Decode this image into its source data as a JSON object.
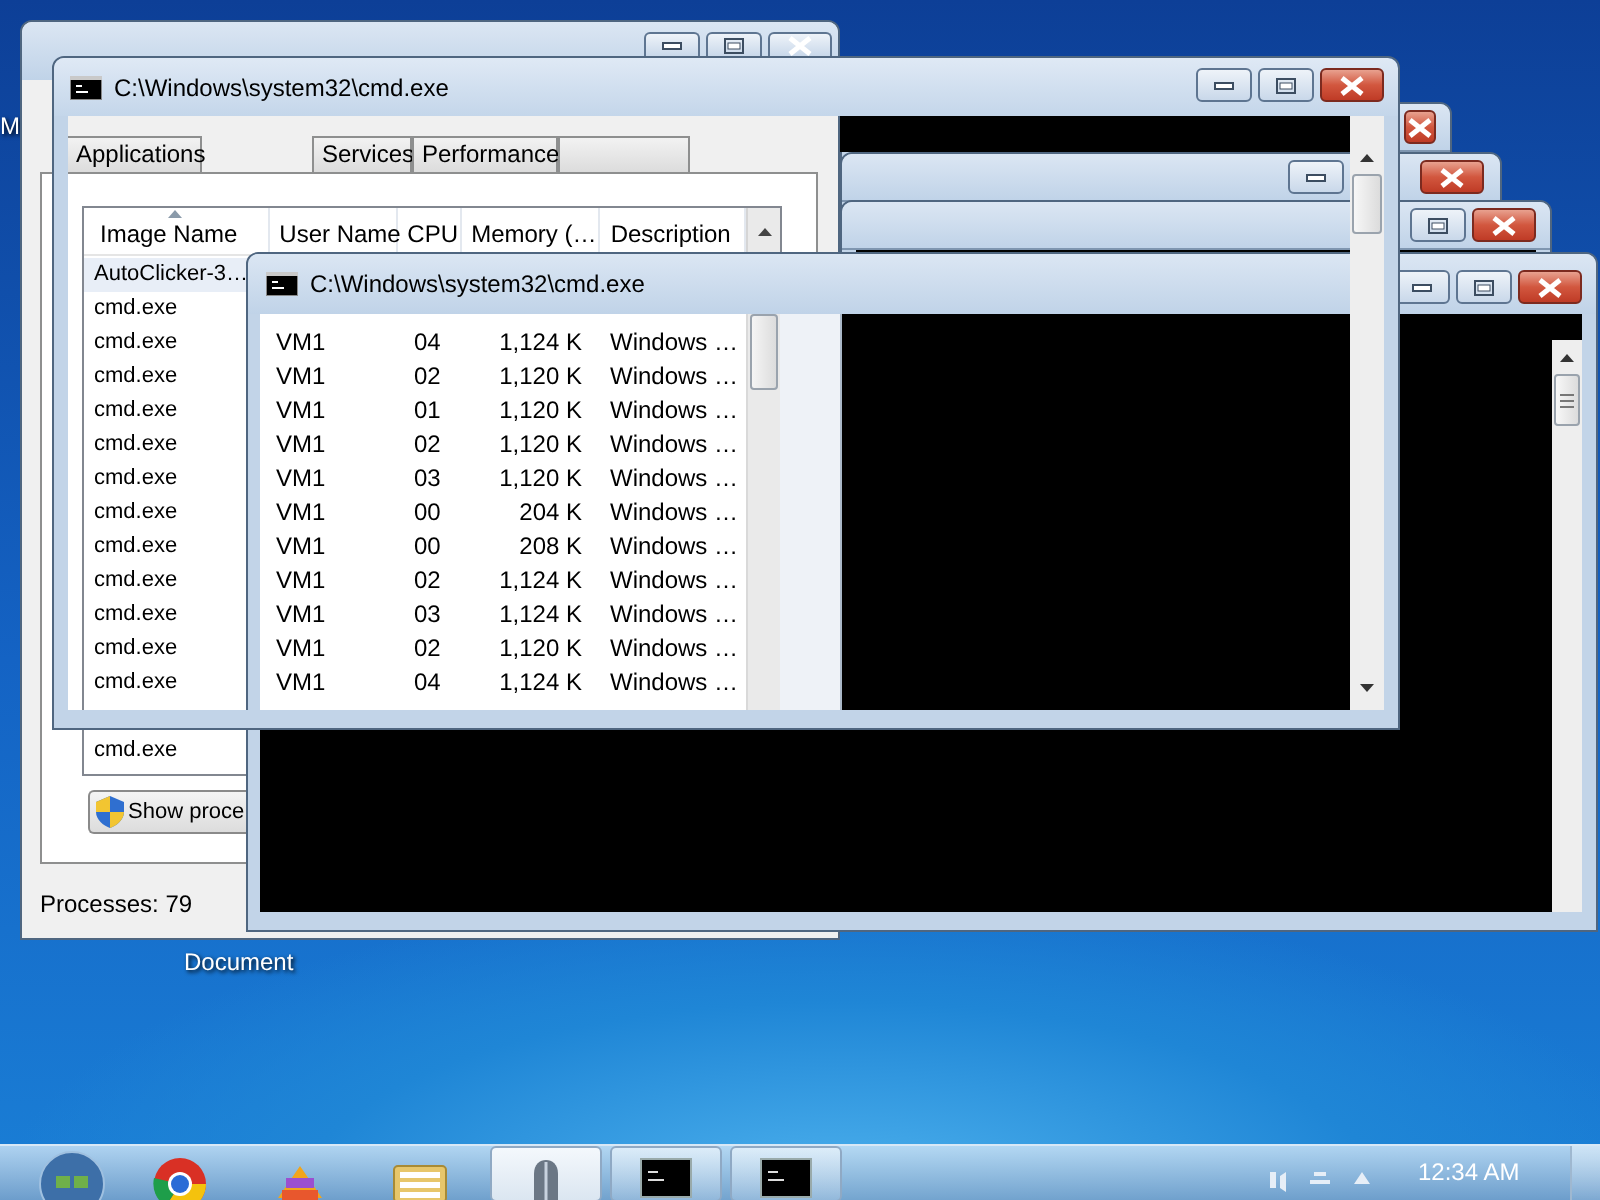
{
  "desktop": {
    "edge_label": "M",
    "icon_label": "Document"
  },
  "task_manager": {
    "tabs": [
      "Applications",
      "Services",
      "Performance"
    ],
    "columns": [
      "Image Name",
      "User Name",
      "CPU",
      "Memory (…",
      "Description"
    ],
    "image_names": [
      "AutoClicker-3…",
      "cmd.exe",
      "cmd.exe",
      "cmd.exe",
      "cmd.exe",
      "cmd.exe",
      "cmd.exe",
      "cmd.exe",
      "cmd.exe",
      "cmd.exe",
      "cmd.exe",
      "cmd.exe",
      "cmd.exe"
    ],
    "last_image_name": "cmd.exe",
    "button": "Show proce",
    "status": "Processes: 79"
  },
  "console_windows": [
    {
      "title": "C:\\Windows\\system32\\cmd.exe"
    },
    {
      "title": "C:\\Windows\\system32\\cmd.exe"
    }
  ],
  "process_rows": [
    {
      "user": "VM1",
      "cpu": "04",
      "memory": "1,124 K",
      "description": "Windows …"
    },
    {
      "user": "VM1",
      "cpu": "02",
      "memory": "1,120 K",
      "description": "Windows …"
    },
    {
      "user": "VM1",
      "cpu": "01",
      "memory": "1,120 K",
      "description": "Windows …"
    },
    {
      "user": "VM1",
      "cpu": "02",
      "memory": "1,120 K",
      "description": "Windows …"
    },
    {
      "user": "VM1",
      "cpu": "03",
      "memory": "1,120 K",
      "description": "Windows …"
    },
    {
      "user": "VM1",
      "cpu": "00",
      "memory": "204 K",
      "description": "Windows …"
    },
    {
      "user": "VM1",
      "cpu": "00",
      "memory": "208 K",
      "description": "Windows …"
    },
    {
      "user": "VM1",
      "cpu": "02",
      "memory": "1,124 K",
      "description": "Windows …"
    },
    {
      "user": "VM1",
      "cpu": "03",
      "memory": "1,124 K",
      "description": "Windows …"
    },
    {
      "user": "VM1",
      "cpu": "02",
      "memory": "1,120 K",
      "description": "Windows …"
    },
    {
      "user": "VM1",
      "cpu": "04",
      "memory": "1,124 K",
      "description": "Windows …"
    }
  ],
  "taskbar": {
    "clock": "12:34 AM"
  }
}
